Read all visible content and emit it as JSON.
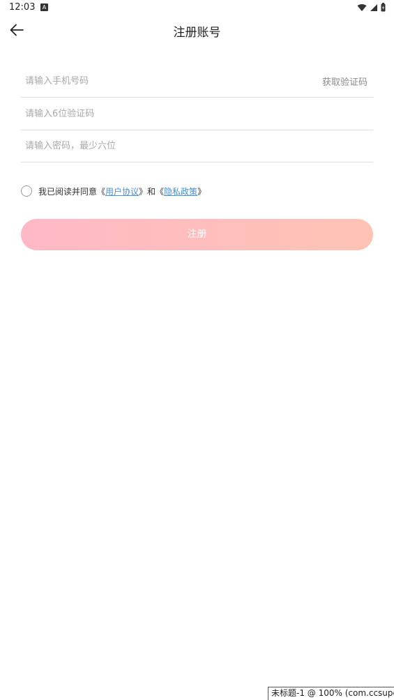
{
  "status_bar": {
    "time": "12:03",
    "notification_icon": "a-icon",
    "icons": [
      "wifi-icon",
      "signal-icon",
      "battery-icon"
    ]
  },
  "header": {
    "back_icon": "arrow-left-icon",
    "title": "注册账号"
  },
  "form": {
    "phone_placeholder": "请输入手机号码",
    "phone_value": "",
    "get_code_label": "获取验证码",
    "code_placeholder": "请输入6位验证码",
    "code_value": "",
    "password_placeholder": "请输入密码，最少六位",
    "password_value": ""
  },
  "agreement": {
    "checked": false,
    "prefix": "我已阅读并同意《",
    "user_agreement": "用户协议",
    "middle": "》和《",
    "privacy_policy": "隐私政策",
    "suffix": "》"
  },
  "register_button": {
    "label": "注册",
    "gradient_start": "#ffb9c6",
    "gradient_end": "#ffc3b4"
  },
  "debug_overlay": {
    "text": "未标题-1 @ 100% (com.ccsupe"
  },
  "colors": {
    "link": "#4a90d9",
    "placeholder": "#a8a8a8",
    "divider": "#dedede"
  }
}
